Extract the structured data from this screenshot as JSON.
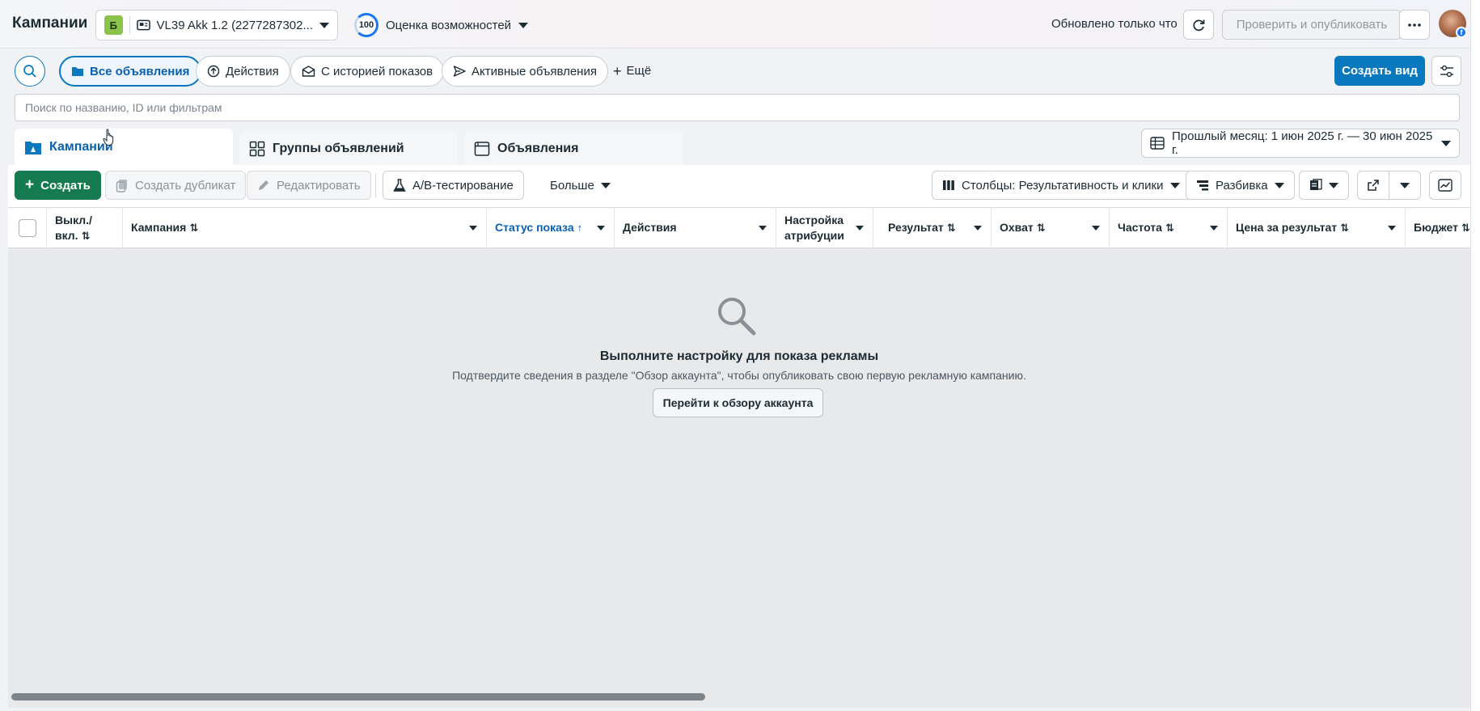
{
  "header": {
    "title": "Кампании",
    "account_badge": "Б",
    "account_name": "VL39 Akk 1.2 (2277287302...",
    "opportunity_score": "100",
    "opportunity_label": "Оценка возможностей",
    "updated": "Обновлено только что",
    "publish_label": "Проверить и опубликовать"
  },
  "filters": {
    "chips": [
      "Все объявления",
      "Действия",
      "С историей показов",
      "Активные объявления"
    ],
    "more": "Ещё",
    "create_view": "Создать вид",
    "search_placeholder": "Поиск по названию, ID или фильтрам"
  },
  "level_tabs": [
    "Кампании",
    "Группы объявлений",
    "Объявления"
  ],
  "date_range": "Прошлый месяц: 1 июн 2025 г. — 30 июн 2025 г.",
  "toolbar": {
    "create": "Создать",
    "duplicate": "Создать дубликат",
    "edit": "Редактировать",
    "ab_test": "A/B-тестирование",
    "more": "Больше",
    "columns": "Столбцы: Результативность и клики",
    "breakdown": "Разбивка"
  },
  "table": {
    "headers": {
      "toggle": "Выкл./ вкл.",
      "campaign": "Кампания",
      "status": "Статус показа",
      "actions": "Действия",
      "attribution": "Настройка атрибуции",
      "result": "Результат",
      "reach": "Охват",
      "frequency": "Частота",
      "cost_per_result": "Цена за результат",
      "budget": "Бюджет"
    }
  },
  "empty_state": {
    "title": "Выполните настройку для показа рекламы",
    "description": "Подтвердите сведения в разделе \"Обзор аккаунта\", чтобы опубликовать свою первую рекламную кампанию.",
    "button": "Перейти к обзору аккаунта"
  },
  "colors": {
    "accent_blue": "#0a78be",
    "create_green": "#157a4f",
    "account_badge_green": "#8bc34a"
  }
}
